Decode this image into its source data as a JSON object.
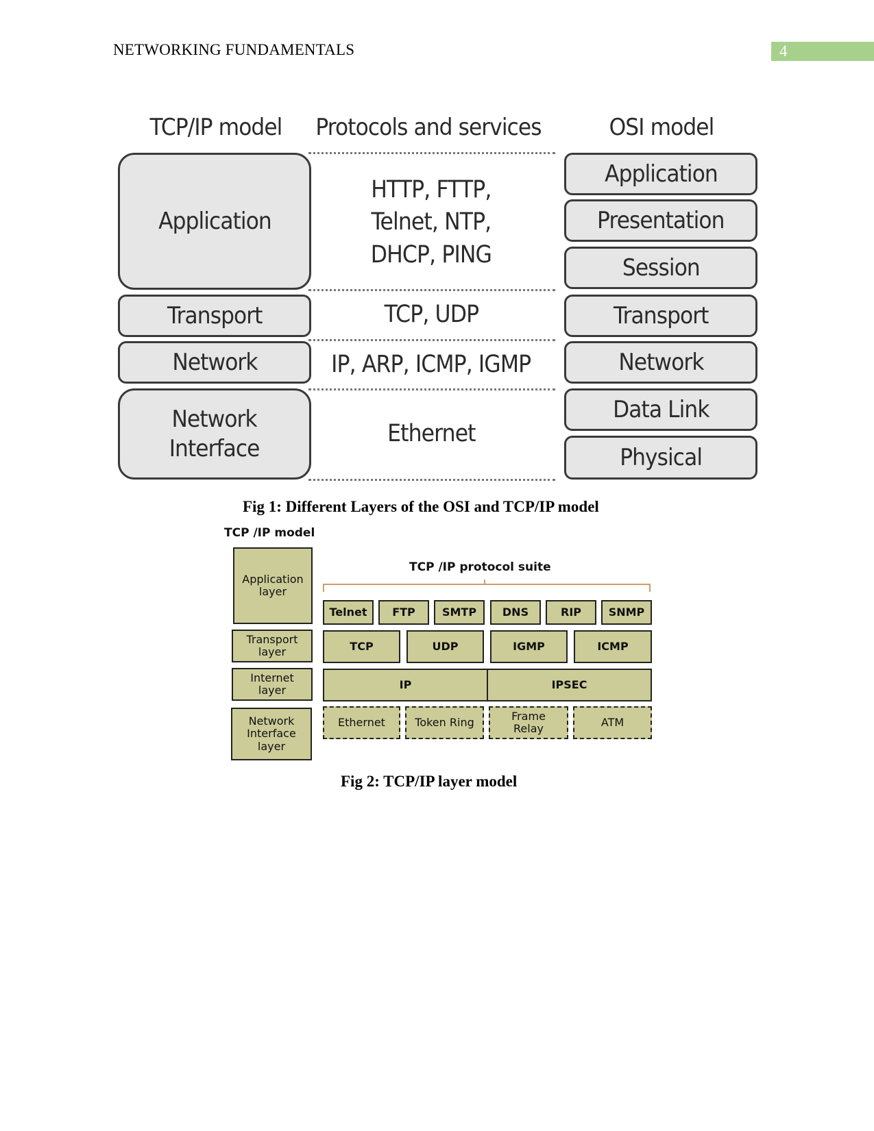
{
  "header": {
    "title": "NETWORKING FUNDAMENTALS",
    "page_number": "4",
    "accent_color": "#a8d08d"
  },
  "figure1": {
    "headings": {
      "tcpip": "TCP/IP model",
      "protocols": "Protocols and services",
      "osi": "OSI model"
    },
    "tcpip_layers": [
      "Application",
      "Transport",
      "Network",
      "Network\nInterface"
    ],
    "protocols": [
      "HTTP, FTTP,\nTelnet, NTP,\nDHCP, PING",
      "TCP, UDP",
      "IP, ARP, ICMP, IGMP",
      "Ethernet"
    ],
    "osi_layers": [
      "Application",
      "Presentation",
      "Session",
      "Transport",
      "Network",
      "Data Link",
      "Physical"
    ],
    "caption": "Fig 1: Different Layers of the OSI and TCP/IP model"
  },
  "figure2": {
    "title": "TCP /IP model",
    "suite_label": "TCP /IP protocol suite",
    "layers": [
      "Application\nlayer",
      "Transport\nlayer",
      "Internet\nlayer",
      "Network\nInterface\nlayer"
    ],
    "application_protocols": [
      "Telnet",
      "FTP",
      "SMTP",
      "DNS",
      "RIP",
      "SNMP"
    ],
    "transport_protocols": [
      "TCP",
      "UDP",
      "IGMP",
      "ICMP"
    ],
    "internet_protocols": [
      "IP",
      "IPSEC"
    ],
    "network_interface_protocols": [
      "Ethernet",
      "Token Ring",
      "Frame\nRelay",
      "ATM"
    ],
    "fill_color": "#cccc99",
    "caption": "Fig 2: TCP/IP layer model"
  }
}
